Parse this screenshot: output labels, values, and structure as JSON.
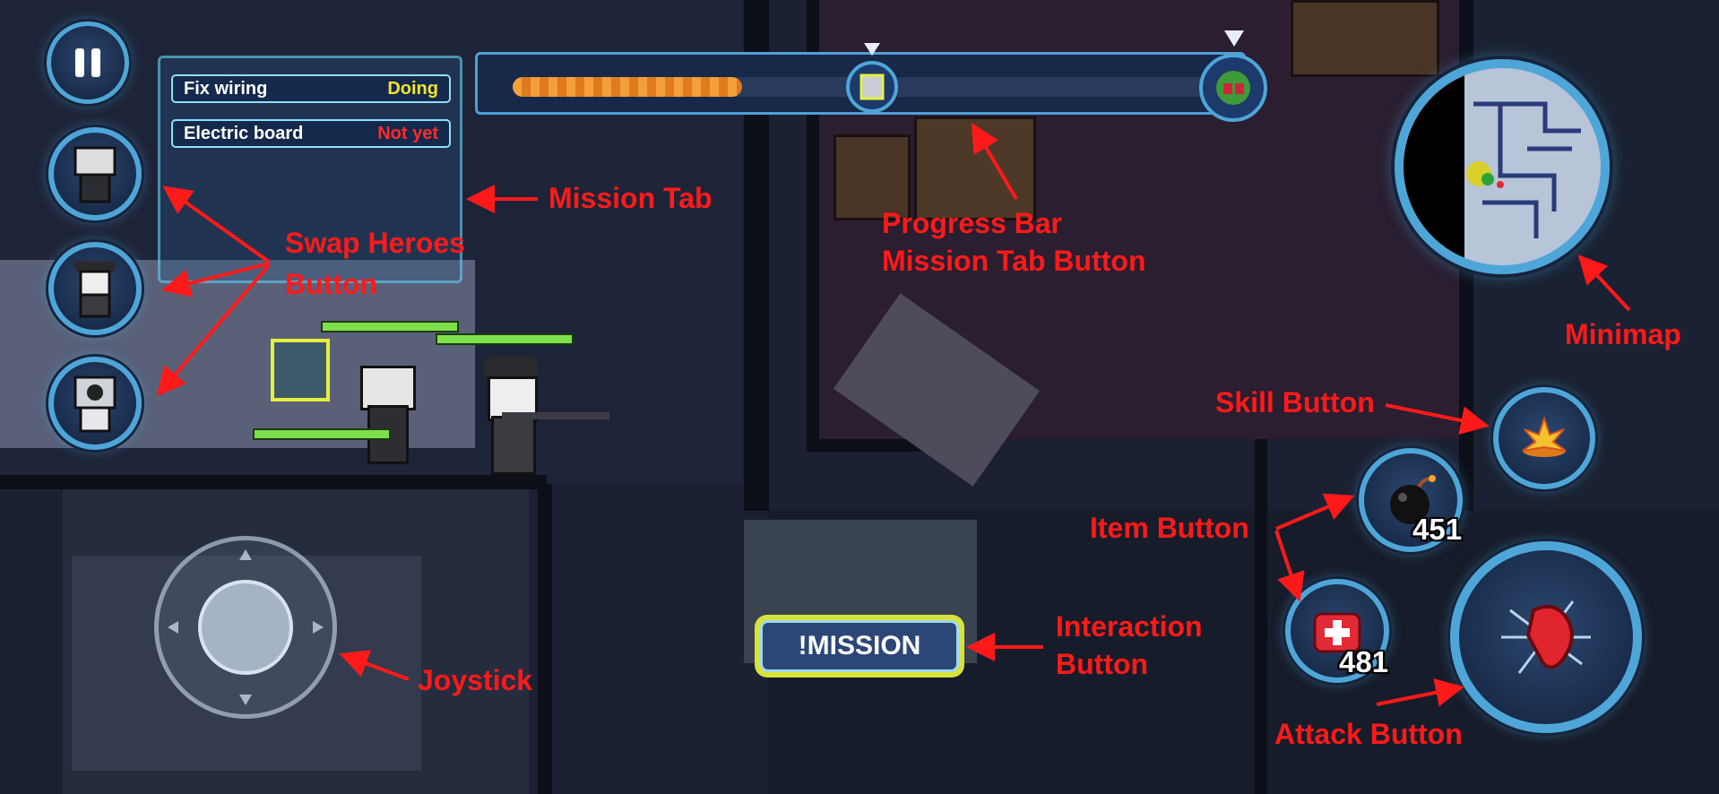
{
  "hud": {
    "pause_label": "",
    "mission_tab": {
      "rows": [
        {
          "name": "Fix wiring",
          "status": "Doing",
          "status_color": "#f2e52a"
        },
        {
          "name": "Electric board",
          "status": "Not yet",
          "status_color": "#ff2a2a"
        }
      ]
    },
    "progress_bar": {
      "fill_fraction": 0.32
    },
    "item_bomb": {
      "count": "451",
      "icon": "bomb-icon"
    },
    "item_medkit": {
      "count": "481",
      "icon": "medkit-icon"
    },
    "skill_icon": "explosion-icon",
    "attack_icon": "punch-fist-icon",
    "interaction_button": {
      "label": "!MISSION"
    }
  },
  "annotations": {
    "mission_tab": "Mission Tab",
    "swap_heroes": "Swap Heroes",
    "swap_heroes_2": "Button",
    "progress_bar": "Progress Bar",
    "progress_bar_2": "Mission Tab Button",
    "minimap": "Minimap",
    "skill_button": "Skill Button",
    "item_button": "Item Button",
    "interaction_button": "Interaction",
    "interaction_button_2": "Button",
    "joystick": "Joystick",
    "attack_button": "Attack Button"
  },
  "colors": {
    "annotation": "#ff1a1a",
    "hud_ring": "#4ea6d8",
    "progress_fill": "#f3a03a",
    "health": "#7ee04a"
  }
}
